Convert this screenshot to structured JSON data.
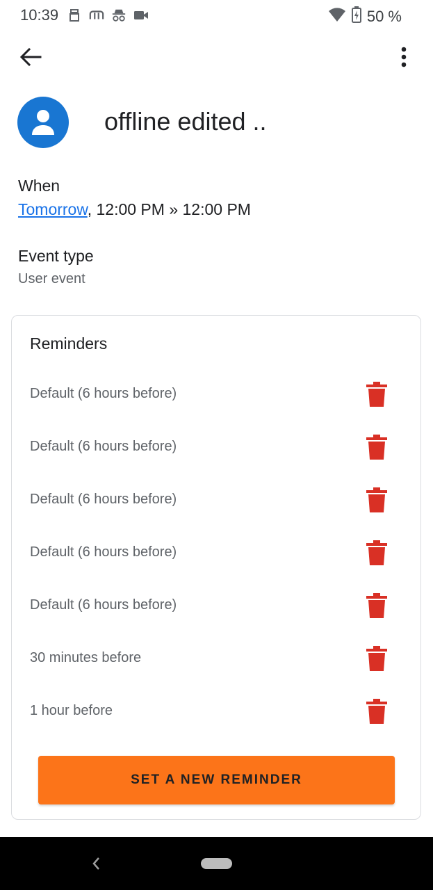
{
  "status_bar": {
    "time": "10:39",
    "left_icons": [
      "sim-icon",
      "notification-icon",
      "incognito-icon",
      "video-icon"
    ],
    "battery_text": "50 %"
  },
  "app_bar": {
    "back_icon": "arrow-back-icon",
    "more_icon": "more-vert-icon"
  },
  "event": {
    "title": "offline edited ..",
    "avatar_color": "#1976d2"
  },
  "when": {
    "label": "When",
    "day_link": "Tomorrow",
    "time_range": ", 12:00 PM » 12:00 PM"
  },
  "event_type": {
    "label": "Event type",
    "value": "User event"
  },
  "reminders": {
    "title": "Reminders",
    "items": [
      {
        "label": "Default (6 hours before)"
      },
      {
        "label": "Default (6 hours before)"
      },
      {
        "label": "Default (6 hours before)"
      },
      {
        "label": "Default (6 hours before)"
      },
      {
        "label": "Default (6 hours before)"
      },
      {
        "label": "30 minutes before"
      },
      {
        "label": "1 hour before"
      }
    ],
    "delete_color": "#d93025",
    "new_button_label": "SET A NEW REMINDER",
    "new_button_color": "#fc7419"
  }
}
